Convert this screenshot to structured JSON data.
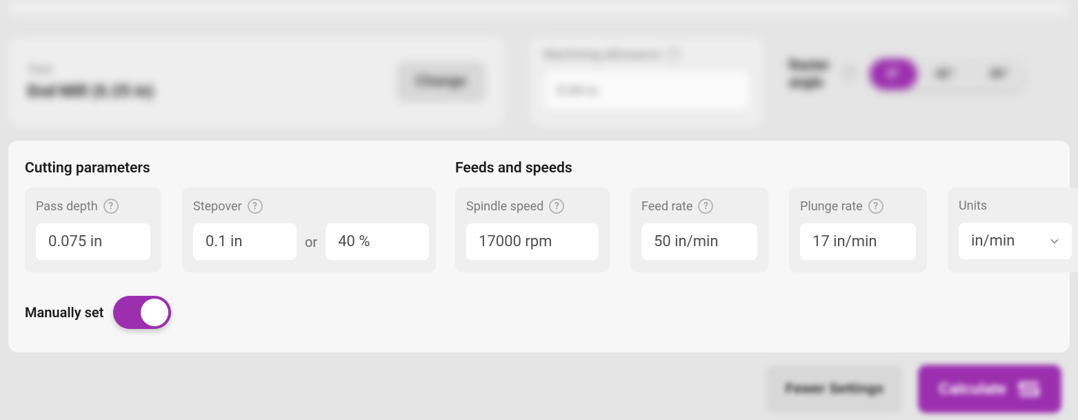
{
  "tool": {
    "label": "Tool",
    "name": "End Mill (0.25 in)",
    "change_label": "Change"
  },
  "machining_allowance": {
    "label": "Machining allowance",
    "value": "0.04 in"
  },
  "raster": {
    "label": "Raster angle",
    "options": [
      "0°",
      "45°",
      "90°"
    ],
    "selected": "0°"
  },
  "cutting": {
    "title": "Cutting parameters",
    "pass_depth": {
      "label": "Pass depth",
      "value": "0.075 in"
    },
    "stepover": {
      "label": "Stepover",
      "value_len": "0.1 in",
      "or": "or",
      "value_pct": "40 %"
    }
  },
  "feeds": {
    "title": "Feeds and speeds",
    "spindle": {
      "label": "Spindle speed",
      "value": "17000 rpm"
    },
    "feed_rate": {
      "label": "Feed rate",
      "value": "50 in/min"
    },
    "plunge_rate": {
      "label": "Plunge rate",
      "value": "17 in/min"
    },
    "units": {
      "label": "Units",
      "value": "in/min"
    }
  },
  "manual": {
    "label": "Manually set",
    "on": true
  },
  "footer": {
    "fewer": "Fewer Settings",
    "calculate": "Calculate"
  },
  "colors": {
    "accent": "#9b2fae"
  }
}
